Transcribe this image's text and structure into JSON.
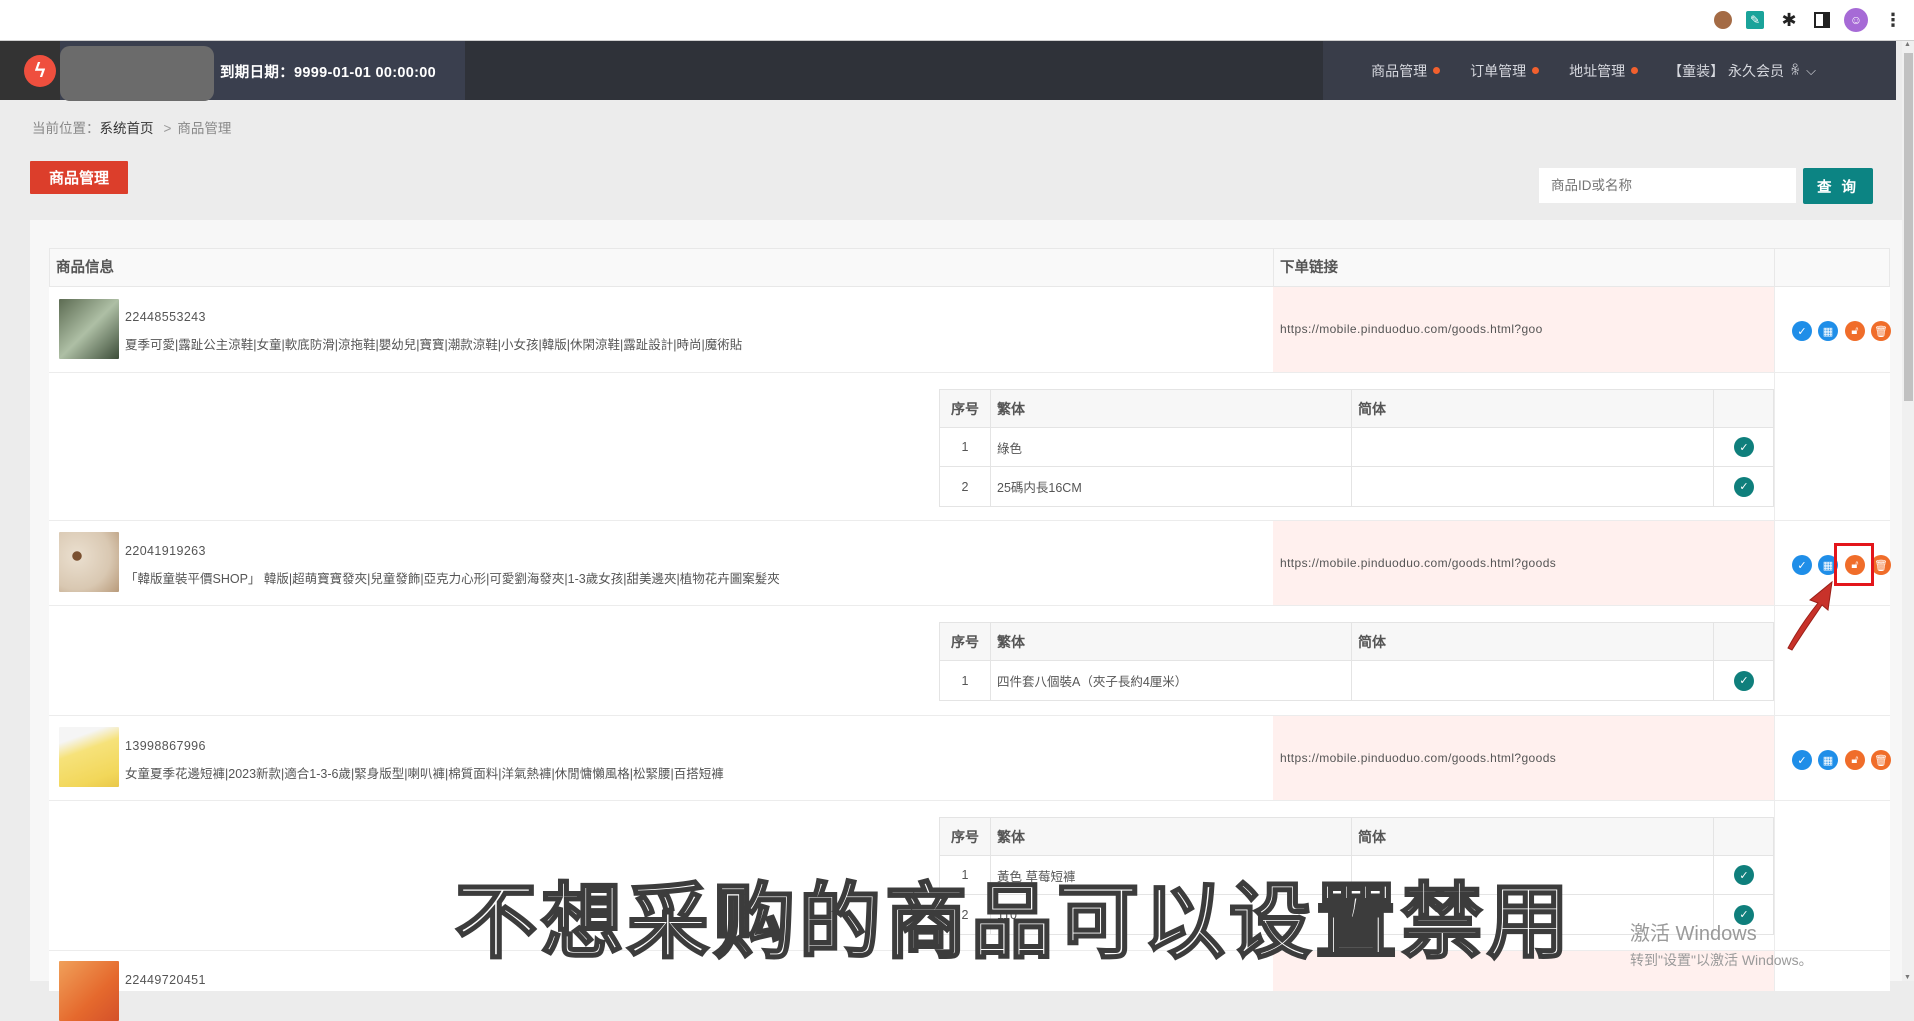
{
  "browser": {
    "extensions": [
      "cookie-icon",
      "pen-extension-icon",
      "puzzle-icon",
      "side-panel-icon",
      "profile-avatar",
      "menu-dots-icon"
    ]
  },
  "header": {
    "expiry_label": "到期日期：9999-01-01 00:00:00",
    "nav": [
      {
        "label": "商品管理",
        "has_dot": true
      },
      {
        "label": "订单管理",
        "has_dot": true
      },
      {
        "label": "地址管理",
        "has_dot": true
      }
    ],
    "user_label": "【童装】 永久会员",
    "accent_dot_color": "#f2602e"
  },
  "breadcrumb": {
    "prefix": "当前位置：",
    "home": "系统首页",
    "separator": ">",
    "current": "商品管理"
  },
  "page": {
    "title_button": "商品管理",
    "search": {
      "placeholder": "商品ID或名称",
      "value": "",
      "button_label": "查 询"
    }
  },
  "table": {
    "headers": {
      "info": "商品信息",
      "link": "下单链接",
      "actions": ""
    },
    "sub_headers": {
      "index": "序号",
      "traditional": "繁体",
      "simplified": "简体"
    },
    "products": [
      {
        "id": "22448553243",
        "name": "夏季可愛|露趾公主涼鞋|女童|軟底防滑|涼拖鞋|嬰幼兒|寶寶|潮款涼鞋|小女孩|韓版|休閑涼鞋|露趾設計|時尚|魔術貼",
        "link": "https://mobile.pinduoduo.com/goods.html?goo",
        "variants": [
          {
            "index": "1",
            "traditional": "綠色",
            "simplified": ""
          },
          {
            "index": "2",
            "traditional": "25碼内長16CM",
            "simplified": ""
          }
        ]
      },
      {
        "id": "22041919263",
        "name": "「韓版童裝平價SHOP」 韓版|超萌寶寶發夾|兒童發飾|亞克力心形|可愛劉海發夾|1-3歲女孩|甜美邊夾|植物花卉圖案髮夾",
        "link": "https://mobile.pinduoduo.com/goods.html?goods",
        "variants": [
          {
            "index": "1",
            "traditional": "四件套八個裝A（夾子長約4厘米）",
            "simplified": ""
          }
        ]
      },
      {
        "id": "13998867996",
        "name": "女童夏季花邊短褲|2023新款|適合1-3-6歲|緊身版型|喇叭褲|棉質面料|洋氣熱褲|休閒慵懶風格|松緊腰|百搭短褲",
        "link": "https://mobile.pinduoduo.com/goods.html?goods",
        "variants": [
          {
            "index": "1",
            "traditional": "黃色 草莓短褲",
            "simplified": ""
          },
          {
            "index": "2",
            "traditional": "110",
            "simplified": ""
          }
        ]
      },
      {
        "id": "22449720451",
        "name": "",
        "link": "",
        "variants": []
      }
    ],
    "action_icons": [
      "check-icon",
      "grid-icon",
      "unlock-icon",
      "trash-icon"
    ]
  },
  "overlay": {
    "subtitle": "不想采购的商品可以设置禁用",
    "watermark_title": "激活 Windows",
    "watermark_sub": "转到\"设置\"以激活 Windows。"
  }
}
